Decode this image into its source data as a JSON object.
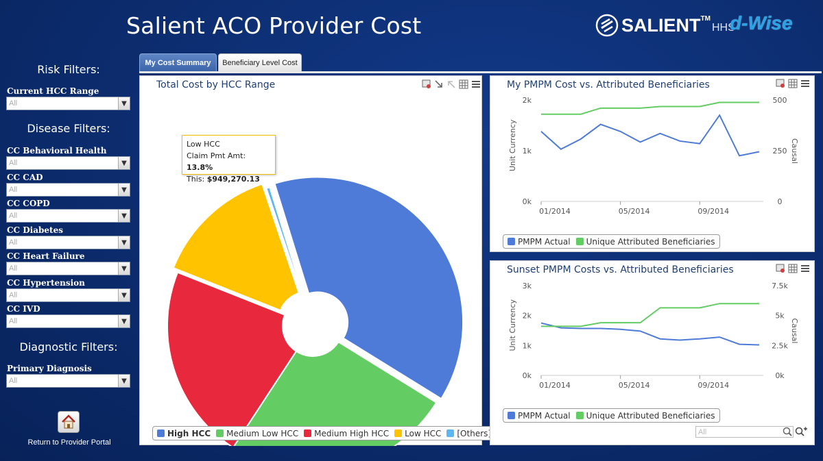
{
  "header": {
    "title": "Salient ACO Provider Cost",
    "brand_name": "SALIENT",
    "brand_tm": "TM",
    "brand_hhs": "HHS",
    "partner": "d-Wise"
  },
  "sidebar": {
    "risk_title": "Risk Filters:",
    "disease_title": "Disease Filters:",
    "diagnostic_title": "Diagnostic Filters:",
    "filters": [
      {
        "label": "Current HCC Range",
        "value": "All"
      },
      {
        "label": "CC Behavioral Health",
        "value": "All"
      },
      {
        "label": "CC CAD",
        "value": "All"
      },
      {
        "label": "CC COPD",
        "value": "All"
      },
      {
        "label": "CC Diabetes",
        "value": "All"
      },
      {
        "label": "CC Heart Failure",
        "value": "All"
      },
      {
        "label": "CC Hypertension",
        "value": "All"
      },
      {
        "label": "CC IVD",
        "value": "All"
      },
      {
        "label": "Primary Diagnosis",
        "value": "All"
      }
    ],
    "return_label": "Return to Provider Portal"
  },
  "tabs": [
    {
      "label": "My Cost Summary",
      "active": true
    },
    {
      "label": "Beneficiary Level Cost",
      "active": false
    }
  ],
  "pie_panel": {
    "title": "Total Cost by HCC Range",
    "tooltip": {
      "category": "Low HCC",
      "measure_label": "Claim Pmt Amt:",
      "measure_value": "13.8%",
      "this_label": "This:",
      "this_value": "$949,270.13"
    },
    "legend": [
      {
        "label": "High HCC",
        "color": "#4f7bd8",
        "bold": true
      },
      {
        "label": "Medium Low HCC",
        "color": "#63cc63"
      },
      {
        "label": "Medium High HCC",
        "color": "#e8283d"
      },
      {
        "label": "Low HCC",
        "color": "#ffc300"
      },
      {
        "label": "[Others]",
        "color": "#5eb7f0"
      }
    ]
  },
  "line_panel_1": {
    "title": "My PMPM Cost vs. Attributed Beneficiaries",
    "y_left_label": "Unit Currency",
    "y_right_label": "Causal",
    "legend": [
      "PMPM Actual",
      "Unique Attributed Beneficiaries"
    ]
  },
  "line_panel_2": {
    "title": "Sunset PMPM Costs vs. Attributed Beneficiaries",
    "y_left_label": "Unit Currency",
    "y_right_label": "Causal",
    "legend": [
      "PMPM Actual",
      "Unique Attributed Beneficiaries"
    ],
    "search_placeholder": "All"
  },
  "colors": {
    "blue": "#4f7bd8",
    "green": "#63cc63",
    "red": "#e8283d",
    "yellow": "#ffc300",
    "background": "#0c2c6e"
  },
  "chart_data": [
    {
      "type": "pie",
      "title": "Total Cost by HCC Range",
      "donut": true,
      "categories": [
        "High HCC",
        "Medium Low HCC",
        "Medium High HCC",
        "Low HCC",
        "[Others]"
      ],
      "values": [
        38.6,
        25.4,
        21.8,
        13.8,
        0.4
      ],
      "exploded": [
        "High HCC",
        "Low HCC"
      ]
    },
    {
      "type": "line",
      "title": "My PMPM Cost vs. Attributed Beneficiaries",
      "x_ticks": [
        "01/2014",
        "05/2014",
        "09/2014"
      ],
      "x": [
        "01/2014",
        "02/2014",
        "03/2014",
        "04/2014",
        "05/2014",
        "06/2014",
        "07/2014",
        "08/2014",
        "09/2014",
        "10/2014",
        "11/2014",
        "12/2014"
      ],
      "y_left_ticks": [
        "0k",
        "1k",
        "2k"
      ],
      "y_right_ticks": [
        "0",
        "250",
        "500"
      ],
      "ylim_left": [
        0,
        2000
      ],
      "ylim_right": [
        0,
        500
      ],
      "series": [
        {
          "name": "PMPM Actual",
          "axis": "left",
          "color": "#4f7bd8",
          "values": [
            1380,
            1030,
            1230,
            1520,
            1380,
            1170,
            1340,
            1190,
            1140,
            1700,
            900,
            980
          ]
        },
        {
          "name": "Unique Attributed Beneficiaries",
          "axis": "right",
          "color": "#63cc63",
          "values": [
            430,
            430,
            430,
            460,
            460,
            460,
            468,
            468,
            468,
            488,
            488,
            488
          ]
        }
      ]
    },
    {
      "type": "line",
      "title": "Sunset PMPM Costs vs. Attributed Beneficiaries",
      "x_ticks": [
        "01/2014",
        "05/2014",
        "09/2014"
      ],
      "x": [
        "01/2014",
        "02/2014",
        "03/2014",
        "04/2014",
        "05/2014",
        "06/2014",
        "07/2014",
        "08/2014",
        "09/2014",
        "10/2014",
        "11/2014",
        "12/2014"
      ],
      "y_left_ticks": [
        "0k",
        "1k",
        "2k",
        "3k"
      ],
      "y_right_ticks": [
        "0k",
        "2.5k",
        "5k",
        "7.5k"
      ],
      "ylim_left": [
        0,
        3000
      ],
      "ylim_right": [
        0,
        7500
      ],
      "series": [
        {
          "name": "PMPM Actual",
          "axis": "left",
          "color": "#4f7bd8",
          "values": [
            1750,
            1590,
            1570,
            1570,
            1540,
            1480,
            1220,
            1180,
            1220,
            1280,
            1040,
            1020
          ]
        },
        {
          "name": "Unique Attributed Beneficiaries",
          "axis": "right",
          "color": "#63cc63",
          "values": [
            4100,
            4100,
            4100,
            4400,
            4400,
            4400,
            5650,
            5650,
            5650,
            6000,
            6000,
            6000
          ]
        }
      ]
    }
  ]
}
